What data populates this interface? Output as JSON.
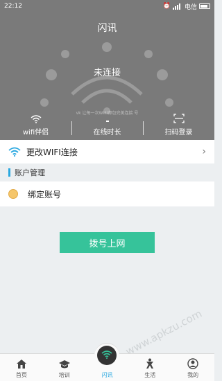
{
  "status_bar": {
    "time": "22:12",
    "carrier": "电信"
  },
  "header": {
    "title": "闪讯"
  },
  "hero": {
    "connection_status": "未连接",
    "tip": "vk 让每一次WIFI都包完美连接 号",
    "actions": [
      {
        "label": "wifi伴侣",
        "icon": "wifi-icon"
      },
      {
        "label": "在线时长",
        "icon": "clock-icon"
      },
      {
        "label": "扫码登录",
        "icon": "scan-icon"
      }
    ]
  },
  "wifi_row": {
    "label": "更改WIFI连接",
    "icon": "wifi-icon",
    "chevron": "›"
  },
  "account_section": {
    "title": "账户管理"
  },
  "bind_row": {
    "label": "绑定账号"
  },
  "dial_button": {
    "label": "拨号上网"
  },
  "watermark": "www.apkzu.com",
  "colors": {
    "accent": "#36c39a",
    "blue": "#2aa8e0",
    "hero_bg": "#7a7a7a"
  },
  "bottom_nav": [
    {
      "label": "首页",
      "icon": "home-icon"
    },
    {
      "label": "培训",
      "icon": "graduation-cap-icon"
    },
    {
      "label": "闪讯",
      "icon": "wifi-icon",
      "active": true
    },
    {
      "label": "生活",
      "icon": "person-icon"
    },
    {
      "label": "我的",
      "icon": "user-circle-icon"
    }
  ]
}
